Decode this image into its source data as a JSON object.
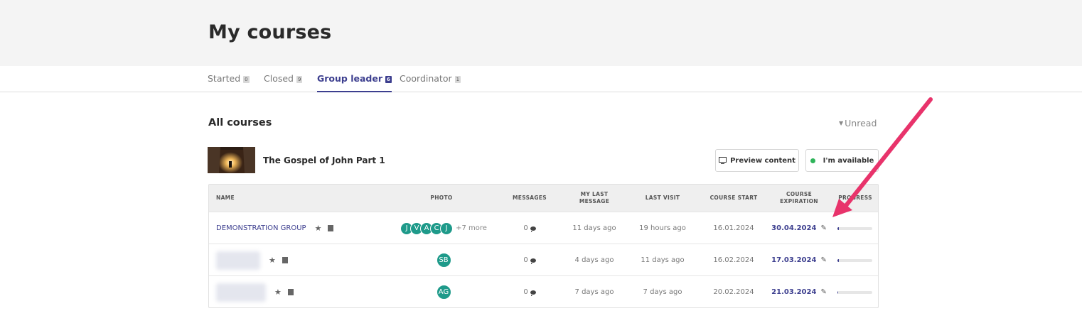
{
  "page": {
    "title": "My courses"
  },
  "tabs": [
    {
      "label": "Started",
      "count": "0",
      "active": false
    },
    {
      "label": "Closed",
      "count": "9",
      "active": false
    },
    {
      "label": "Group leader",
      "count": "6",
      "active": true
    },
    {
      "label": "Coordinator",
      "count": "1",
      "active": false
    }
  ],
  "section": {
    "title": "All courses",
    "filter_label": "Unread"
  },
  "course": {
    "name": "The Gospel of John Part 1"
  },
  "actions": {
    "preview_label": "Preview content",
    "availability_label": "I'm available",
    "availability_color": "#2fb45a"
  },
  "table": {
    "headers": {
      "name": "NAME",
      "photo": "PHOTO",
      "messages": "MESSAGES",
      "last_message": "MY LAST MESSAGE",
      "last_visit": "LAST VISIT",
      "course_start": "COURSE START",
      "course_expiration": "COURSE EXPIRATION",
      "progress": "PROGRESS"
    },
    "rows": [
      {
        "name": "DEMONSTRATION GROUP",
        "avatars": [
          "J",
          "V",
          "A",
          "C",
          "J"
        ],
        "more": "+7 more",
        "messages": "0",
        "last_message": "11 days ago",
        "last_visit": "19 hours ago",
        "start": "16.01.2024",
        "expiration": "30.04.2024",
        "progress": 0.04
      },
      {
        "name": "",
        "avatars": [
          "SB"
        ],
        "more": "",
        "messages": "0",
        "last_message": "4 days ago",
        "last_visit": "11 days ago",
        "start": "16.02.2024",
        "expiration": "17.03.2024",
        "progress": 0.04
      },
      {
        "name": "",
        "avatars": [
          "AG"
        ],
        "more": "",
        "messages": "0",
        "last_message": "7 days ago",
        "last_visit": "7 days ago",
        "start": "20.02.2024",
        "expiration": "21.03.2024",
        "progress": 0.03
      }
    ]
  },
  "colors": {
    "accent": "#3d3f8f",
    "avatar": "#1e9a8a",
    "annotation_arrow": "#e8336b"
  },
  "icons": {
    "star": "star-icon",
    "note": "note-icon",
    "message": "chat-bubble-icon",
    "edit": "pencil-icon",
    "monitor": "monitor-icon"
  }
}
